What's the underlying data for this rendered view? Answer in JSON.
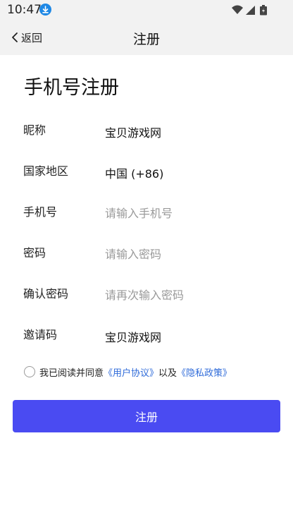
{
  "status_bar": {
    "time": "10:47",
    "icons": [
      "download-icon",
      "wifi-icon",
      "signal-icon",
      "battery-icon"
    ],
    "download_color": "#1e88e5"
  },
  "nav": {
    "back_label": "返回",
    "title": "注册"
  },
  "page_heading": "手机号注册",
  "form": {
    "nickname": {
      "label": "昵称",
      "value": "宝贝游戏网"
    },
    "region": {
      "label": "国家地区",
      "value": "中国 (+86)"
    },
    "phone": {
      "label": "手机号",
      "placeholder": "请输入手机号"
    },
    "password": {
      "label": "密码",
      "placeholder": "请输入密码"
    },
    "confirm_password": {
      "label": "确认密码",
      "placeholder": "请再次输入密码"
    },
    "invite_code": {
      "label": "邀请码",
      "value": "宝贝游戏网"
    }
  },
  "agreement": {
    "checked": false,
    "prefix": "我已阅读并同意",
    "user_agreement": "《用户协议》",
    "conjunction": "以及",
    "privacy_policy": "《隐私政策》",
    "link_color": "#2f6bd9"
  },
  "submit_label": "注册",
  "colors": {
    "primary_button": "#4a4bf2",
    "header_background": "#f2f2f2",
    "placeholder": "#9a9a9a"
  }
}
